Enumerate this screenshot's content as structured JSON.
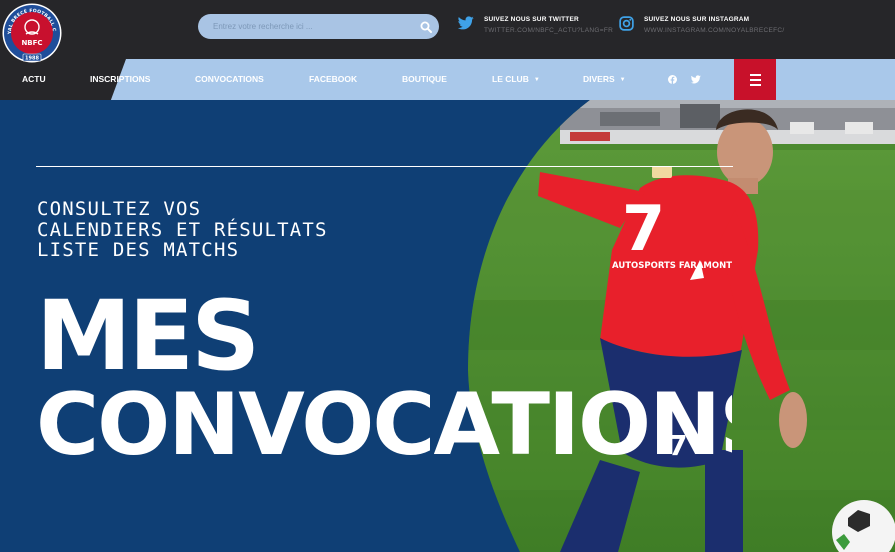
{
  "header": {
    "logo": {
      "club_initials": "NBFC",
      "arc_text": "NOYAL BRECÉ FOOTBALL CLUB",
      "year": "1988",
      "colors": {
        "ring": "#1f4e9a",
        "inner": "#c8102e"
      }
    },
    "search": {
      "placeholder": "Entrez votre recherche ici ...",
      "icon": "search-icon"
    },
    "twitter": {
      "title": "SUIVEZ NOUS SUR TWITTER",
      "handle": "TWITTER.COM/NBFC_ACTU?LANG=FR",
      "icon": "twitter-icon"
    },
    "instagram": {
      "title": "SUIVEZ NOUS SUR INSTAGRAM",
      "handle": "WWW.INSTAGRAM.COM/NOYALBRECEFC/",
      "icon": "instagram-icon"
    }
  },
  "nav": {
    "items": [
      {
        "label": "ACTU"
      },
      {
        "label": "INSCRIPTIONS"
      },
      {
        "label": "CONVOCATIONS"
      },
      {
        "label": "FACEBOOK"
      },
      {
        "label": "BOUTIQUE"
      },
      {
        "label": "LE CLUB",
        "dropdown": true
      },
      {
        "label": "DIVERS",
        "dropdown": true
      }
    ],
    "social_icons": [
      "facebook-icon",
      "twitter-icon"
    ],
    "menu_icon": "hamburger-menu-icon",
    "colors": {
      "bar": "#a9c8ea",
      "dark": "#262629",
      "menu_button": "#c8112a"
    }
  },
  "hero": {
    "subtitle_lines": [
      "CONSULTEZ VOS",
      "CALENDIERS ET RÉSULTATS",
      "LISTE DES MATCHS"
    ],
    "title_line1": "MES",
    "title_line2": "CONVOCATIONS",
    "player_shirt_number": "7",
    "shirt_sponsor": "AUTOSPORTS FARAMONT",
    "colors": {
      "background": "#0f3f75",
      "shirt": "#e8202b",
      "shorts": "#1b2e6e",
      "grass": "#4f8f2e"
    }
  }
}
